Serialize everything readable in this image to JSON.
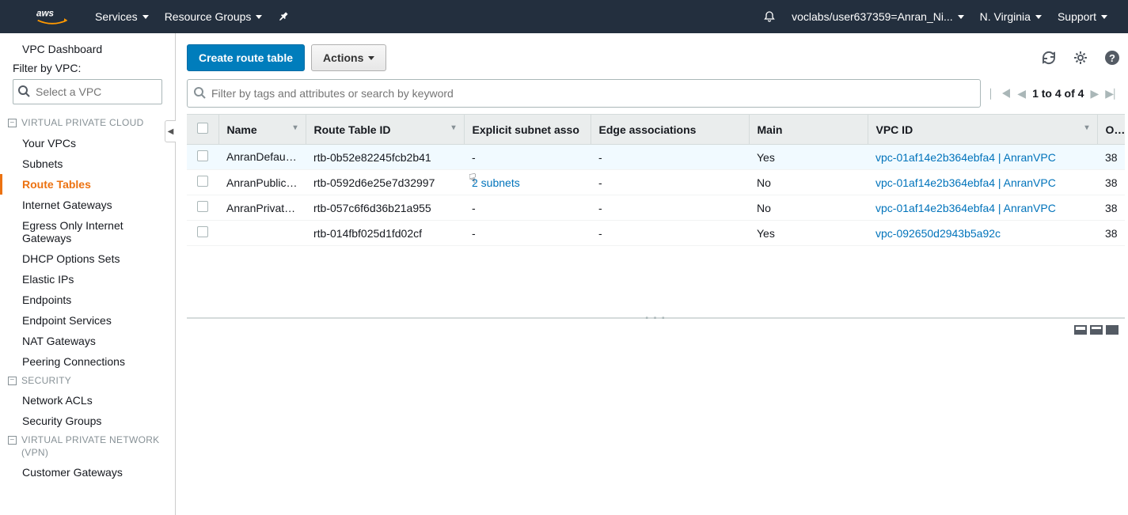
{
  "topnav": {
    "services": "Services",
    "resource_groups": "Resource Groups",
    "user": "voclabs/user637359=Anran_Ni...",
    "region": "N. Virginia",
    "support": "Support"
  },
  "sidebar": {
    "dashboard": "VPC Dashboard",
    "filter_label": "Filter by VPC:",
    "filter_placeholder": "Select a VPC",
    "sections": {
      "vpc": "VIRTUAL PRIVATE CLOUD",
      "security": "SECURITY",
      "vpn": "VIRTUAL PRIVATE NETWORK (VPN)"
    },
    "links": {
      "your_vpcs": "Your VPCs",
      "subnets": "Subnets",
      "route_tables": "Route Tables",
      "igw": "Internet Gateways",
      "eoigw": "Egress Only Internet Gateways",
      "dhcp": "DHCP Options Sets",
      "eips": "Elastic IPs",
      "endpoints": "Endpoints",
      "endpoint_services": "Endpoint Services",
      "nat": "NAT Gateways",
      "peering": "Peering Connections",
      "nacls": "Network ACLs",
      "sg": "Security Groups",
      "cgw": "Customer Gateways"
    }
  },
  "toolbar": {
    "create": "Create route table",
    "actions": "Actions"
  },
  "search": {
    "placeholder": "Filter by tags and attributes or search by keyword"
  },
  "pager": {
    "text": "1 to 4 of 4"
  },
  "table": {
    "headers": {
      "name": "Name",
      "rtid": "Route Table ID",
      "subnet": "Explicit subnet asso",
      "edge": "Edge associations",
      "main": "Main",
      "vpc": "VPC ID",
      "owner": "Ow"
    },
    "rows": [
      {
        "name": "AnranDefau…",
        "rtid": "rtb-0b52e82245fcb2b41",
        "subnet": "-",
        "subnet_link": false,
        "edge": "-",
        "main": "Yes",
        "vpc": "vpc-01af14e2b364ebfa4 | AnranVPC",
        "owner": "38"
      },
      {
        "name": "AnranPublic…",
        "rtid": "rtb-0592d6e25e7d32997",
        "subnet": "2 subnets",
        "subnet_link": true,
        "edge": "-",
        "main": "No",
        "vpc": "vpc-01af14e2b364ebfa4 | AnranVPC",
        "owner": "38"
      },
      {
        "name": "AnranPrivat…",
        "rtid": "rtb-057c6f6d36b21a955",
        "subnet": "-",
        "subnet_link": false,
        "edge": "-",
        "main": "No",
        "vpc": "vpc-01af14e2b364ebfa4 | AnranVPC",
        "owner": "38"
      },
      {
        "name": "",
        "rtid": "rtb-014fbf025d1fd02cf",
        "subnet": "-",
        "subnet_link": false,
        "edge": "-",
        "main": "Yes",
        "vpc": "vpc-092650d2943b5a92c",
        "owner": "38"
      }
    ]
  }
}
